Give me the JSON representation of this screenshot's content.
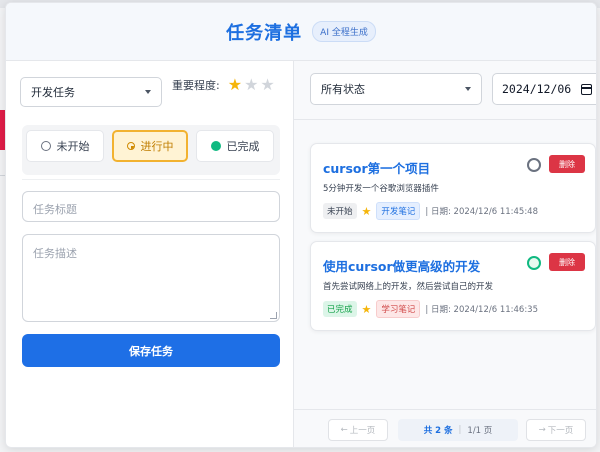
{
  "header": {
    "title": "任务清单",
    "badge": "AI 全程生成"
  },
  "form": {
    "category": "开发任务",
    "importance_label": "重要程度:",
    "importance_rating": 1,
    "importance_max": 3,
    "status_options": [
      {
        "label": "未开始",
        "icon": "empty-circle-icon"
      },
      {
        "label": "进行中",
        "icon": "half-circle-icon",
        "selected": true
      },
      {
        "label": "已完成",
        "icon": "green-dot-icon"
      }
    ],
    "title_placeholder": "任务标题",
    "desc_placeholder": "任务描述",
    "save_label": "保存任务"
  },
  "filter": {
    "status": "所有状态",
    "date": "2024/12/06"
  },
  "tasks": [
    {
      "title": "cursor第一个项目",
      "desc": "5分钟开发一个谷歌浏览器插件",
      "status": "未开始",
      "star": "★",
      "tag": "开发笔记",
      "date": "| 日期: 2024/12/6 11:45:48",
      "delete_label": "删除",
      "ring_color": "#6b7280"
    },
    {
      "title": "使用cursor做更高级的开发",
      "desc": "首先尝试网络上的开发，然后尝试自己的开发",
      "status": "已完成",
      "star": "★",
      "tag": "学习笔记",
      "date": "| 日期: 2024/12/6 11:46:35",
      "delete_label": "删除",
      "ring_color": "#10b981"
    }
  ],
  "pager": {
    "prev": "上一页",
    "total": "共 2 条",
    "pages": "1/1 页",
    "next": "下一页"
  },
  "colors": {
    "accent": "#1e6fe6",
    "danger": "#dc3545",
    "star": "#f5b50a"
  }
}
